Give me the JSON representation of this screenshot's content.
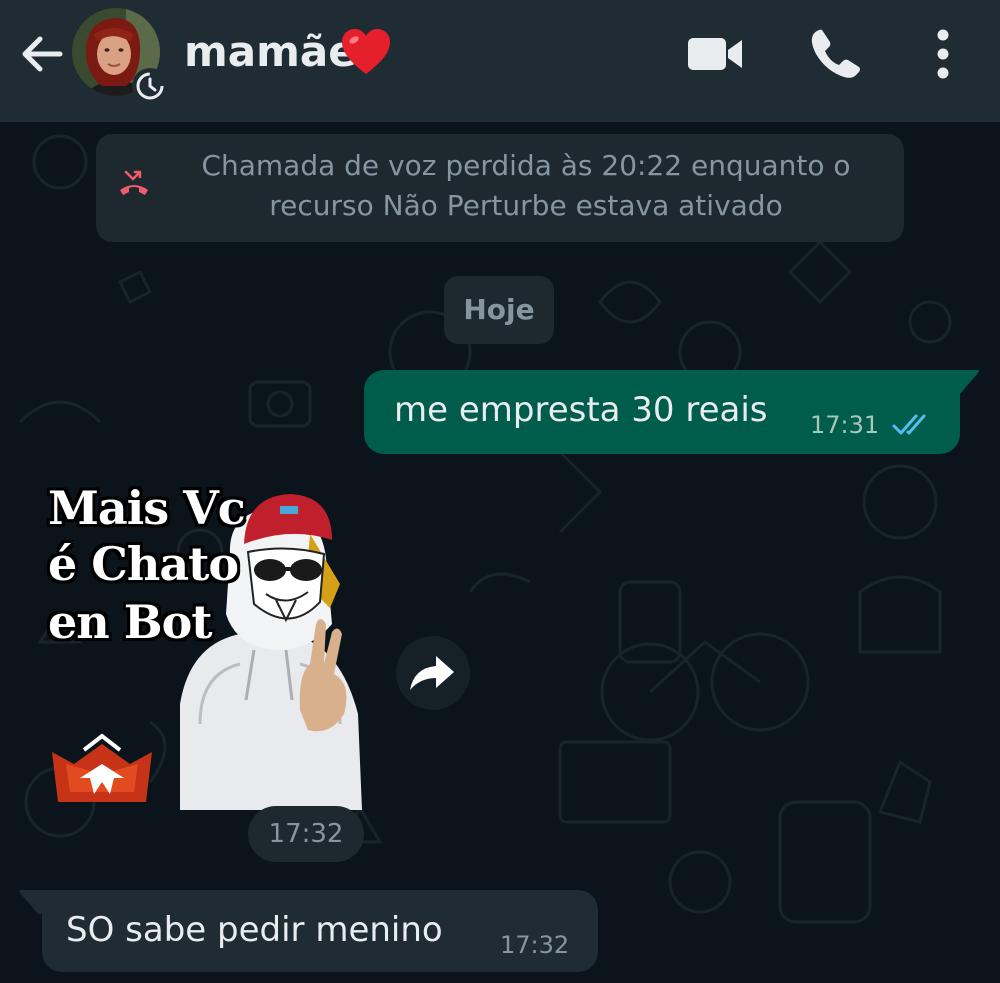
{
  "header": {
    "back_icon": "arrow-left-icon",
    "contact_name": "mamãe",
    "contact_emoji": "heart-emoji",
    "status_badge_icon": "disappearing-timer-icon",
    "actions": [
      "video-camera-icon",
      "phone-icon",
      "more-vertical-icon"
    ]
  },
  "colors": {
    "header_bg": "#1f2c33",
    "chat_bg": "#0b141a",
    "outgoing_bubble": "#005c4b",
    "incoming_bubble": "#1f2c33",
    "read_ticks": "#53bdeb",
    "missed_call": "#f15c6d"
  },
  "chat": {
    "missed_call": {
      "icon": "missed-call-icon",
      "text_line1": "Chamada de voz perdida às 20:22 enquanto o",
      "text_line2": "recurso Não Perturbe estava ativado"
    },
    "date_divider": "Hoje",
    "messages": [
      {
        "direction": "outgoing",
        "text": "me empresta 30 reais",
        "time": "17:31",
        "status": "read"
      },
      {
        "direction": "incoming",
        "type": "sticker",
        "sticker_caption": [
          "Mais Vc",
          "é Chato",
          "en Bot"
        ],
        "time": "17:32",
        "forward_icon": "forward-icon"
      },
      {
        "direction": "incoming",
        "text": "SO sabe pedir menino",
        "time": "17:32"
      }
    ]
  }
}
